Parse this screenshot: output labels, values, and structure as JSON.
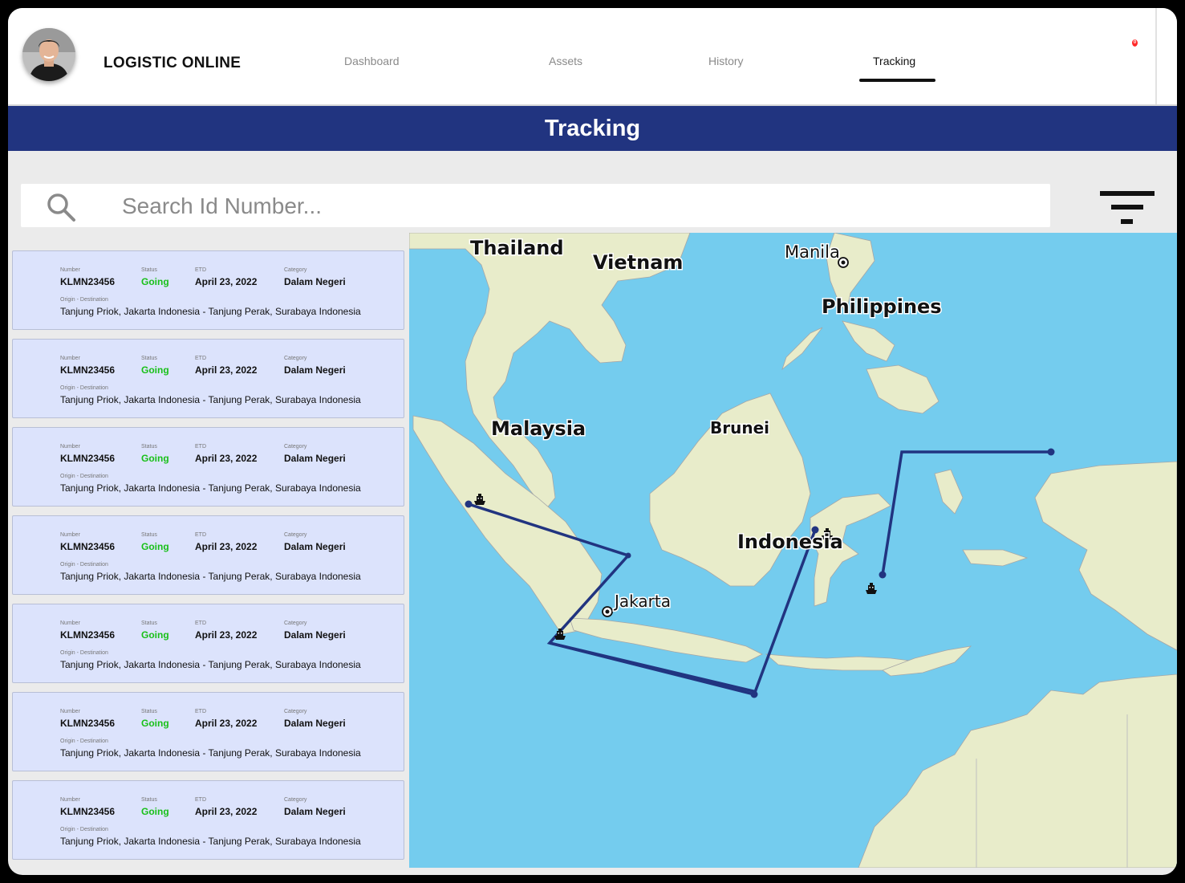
{
  "header": {
    "brand": "LOGISTIC ONLINE",
    "nav": [
      {
        "label": "Dashboard",
        "active": false
      },
      {
        "label": "Assets",
        "active": false
      },
      {
        "label": "History",
        "active": false
      },
      {
        "label": "Tracking",
        "active": true
      }
    ],
    "notification_count": "0"
  },
  "page_title": "Tracking",
  "search": {
    "placeholder": "Search Id Number...",
    "value": ""
  },
  "labels": {
    "number": "Number",
    "status": "Status",
    "etd": "ETD",
    "category": "Category",
    "origin_destination": "Origin - Destination"
  },
  "shipments": [
    {
      "number": "KLMN23456",
      "status": "Going",
      "etd": "April 23, 2022",
      "category": "Dalam Negeri",
      "route": "Tanjung Priok, Jakarta Indonesia - Tanjung Perak, Surabaya Indonesia"
    },
    {
      "number": "KLMN23456",
      "status": "Going",
      "etd": "April 23, 2022",
      "category": "Dalam Negeri",
      "route": "Tanjung Priok, Jakarta Indonesia - Tanjung Perak, Surabaya Indonesia"
    },
    {
      "number": "KLMN23456",
      "status": "Going",
      "etd": "April 23, 2022",
      "category": "Dalam Negeri",
      "route": "Tanjung Priok, Jakarta Indonesia - Tanjung Perak, Surabaya Indonesia"
    },
    {
      "number": "KLMN23456",
      "status": "Going",
      "etd": "April 23, 2022",
      "category": "Dalam Negeri",
      "route": "Tanjung Priok, Jakarta Indonesia - Tanjung Perak, Surabaya Indonesia"
    },
    {
      "number": "KLMN23456",
      "status": "Going",
      "etd": "April 23, 2022",
      "category": "Dalam Negeri",
      "route": "Tanjung Priok, Jakarta Indonesia - Tanjung Perak, Surabaya Indonesia"
    },
    {
      "number": "KLMN23456",
      "status": "Going",
      "etd": "April 23, 2022",
      "category": "Dalam Negeri",
      "route": "Tanjung Priok, Jakarta Indonesia - Tanjung Perak, Surabaya Indonesia"
    },
    {
      "number": "KLMN23456",
      "status": "Going",
      "etd": "April 23, 2022",
      "category": "Dalam Negeri",
      "route": "Tanjung Priok, Jakarta Indonesia - Tanjung Perak, Surabaya Indonesia"
    }
  ],
  "map": {
    "labels": {
      "thailand": "Thailand",
      "vietnam": "Vietnam",
      "manila": "Manila",
      "philippines": "Philippines",
      "malaysia": "Malaysia",
      "brunei": "Brunei",
      "indonesia": "Indonesia",
      "jakarta": "Jakarta"
    }
  },
  "colors": {
    "primary": "#213480",
    "card_bg": "#dce3fc",
    "status_going": "#19c019",
    "sea": "#74ccee",
    "land": "#e8ecca",
    "route": "#213480"
  },
  "icons": [
    "search-icon",
    "filter-icon",
    "ship-icon",
    "location-pin-icon",
    "avatar"
  ]
}
